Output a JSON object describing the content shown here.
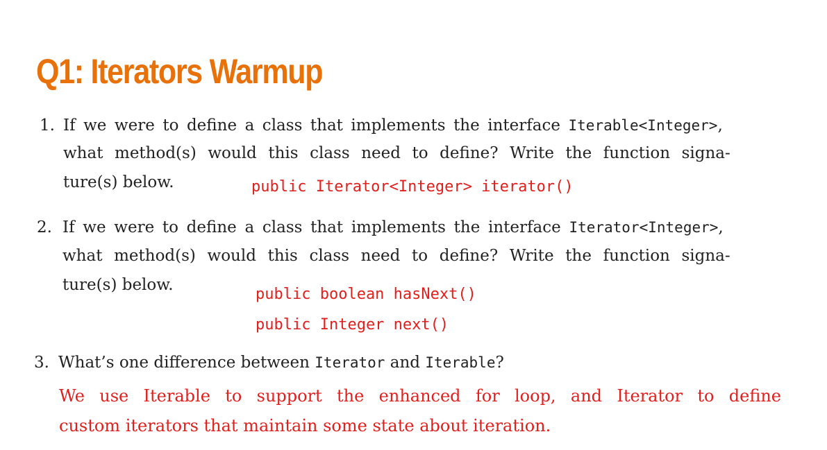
{
  "title": "Q1: Iterators Warmup",
  "q1": {
    "num": "1.",
    "line1_pre": "If we were to define a class that implements the interface ",
    "line1_code": "Iterable<Integer>",
    "line1_post": ",",
    "line2": "what method(s) would this class need to define?  Write the function signa-",
    "line3": "ture(s) below.",
    "answer": "public Iterator<Integer> iterator()"
  },
  "q2": {
    "num": "2.",
    "line1_pre": "If we were to define a class that implements the interface ",
    "line1_code": "Iterator<Integer>",
    "line1_post": ",",
    "line2": "what method(s) would this class need to define?  Write the function signa-",
    "line3": "ture(s) below.",
    "answer1": "public boolean hasNext()",
    "answer2": "public Integer next()"
  },
  "q3": {
    "num": "3.",
    "pre": "What’s one difference between ",
    "code1": "Iterator",
    "mid": " and ",
    "code2": "Iterable",
    "post": "?",
    "answer_line1": "We use Iterable to support the enhanced for loop, and Iterator to define",
    "answer_line2": "custom iterators that maintain some state about iteration."
  }
}
